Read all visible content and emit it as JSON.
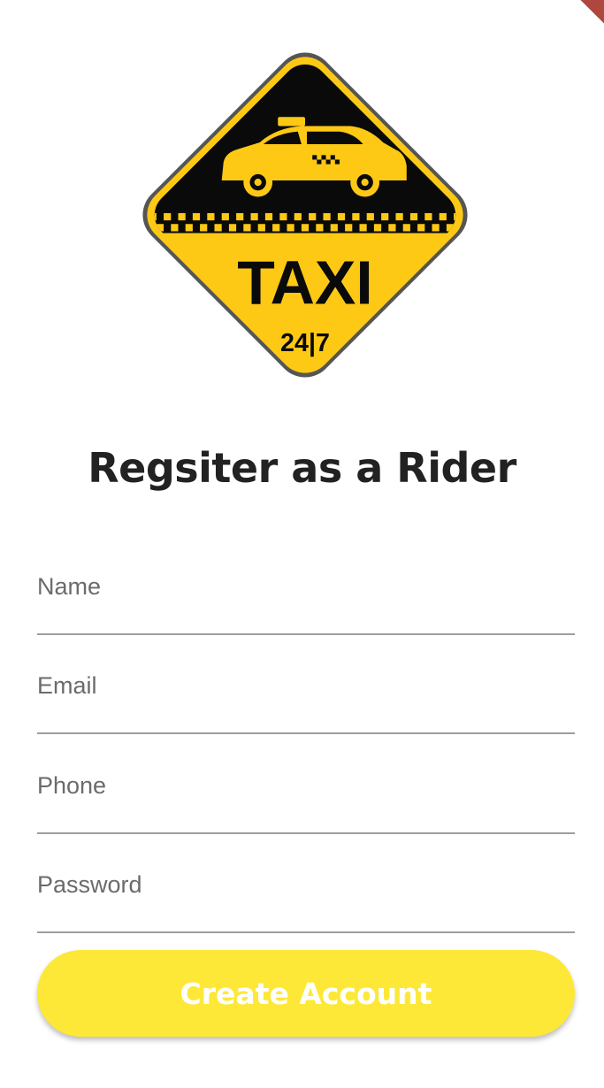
{
  "logo": {
    "text": "TAXI",
    "subtext": "24|7",
    "colors": {
      "yellow": "#fdc915",
      "black": "#0a0a0a",
      "border": "#555555"
    }
  },
  "page": {
    "title": "Regsiter as a Rider"
  },
  "form": {
    "name_placeholder": "Name",
    "email_placeholder": "Email",
    "phone_placeholder": "Phone",
    "password_placeholder": "Password"
  },
  "actions": {
    "create_account_label": "Create Account"
  },
  "colors": {
    "accent": "#fde838",
    "title": "#222222",
    "underline": "#9e9e9e",
    "hint": "#6b6b6b"
  }
}
